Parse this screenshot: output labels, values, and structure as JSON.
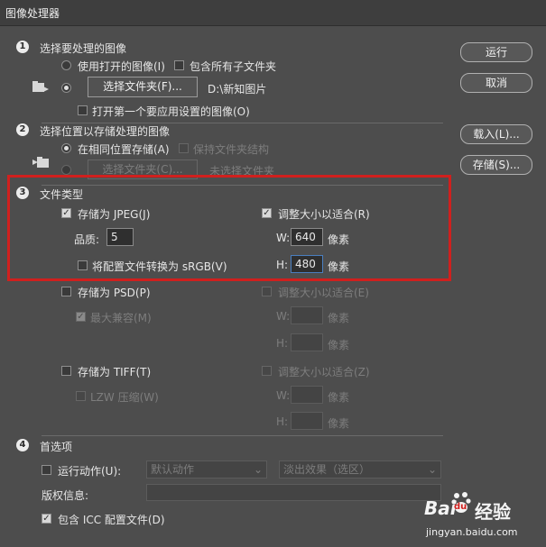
{
  "window": {
    "title": "图像处理器"
  },
  "buttons": {
    "run": "运行",
    "cancel": "取消",
    "load": "载入(L)...",
    "save": "存储(S)..."
  },
  "section1": {
    "number": "1",
    "title": "选择要处理的图像",
    "use_open_label": "使用打开的图像(I)",
    "include_sub_label": "包含所有子文件夹",
    "select_folder_label": "选择文件夹(F)...",
    "folder_path": "D:\\新知图片",
    "open_first_label": "打开第一个要应用设置的图像(O)"
  },
  "section2": {
    "number": "2",
    "title": "选择位置以存储处理的图像",
    "same_location_label": "在相同位置存储(A)",
    "keep_structure_label": "保持文件夹结构",
    "select_folder_label": "选择文件夹(C)...",
    "no_folder_label": "未选择文件夹"
  },
  "section3": {
    "number": "3",
    "title": "文件类型",
    "jpeg_label": "存储为 JPEG(J)",
    "resize_label_r": "调整大小以适合(R)",
    "quality_label": "品质:",
    "quality_value": "5",
    "w_label": "W:",
    "w_value": "640",
    "h_label": "H:",
    "h_value": "480",
    "pixels": "像素",
    "srgb_label": "将配置文件转换为 sRGB(V)",
    "psd_label": "存储为 PSD(P)",
    "resize_label_e": "调整大小以适合(E)",
    "max_compat_label": "最大兼容(M)",
    "tiff_label": "存储为 TIFF(T)",
    "resize_label_z": "调整大小以适合(Z)",
    "lzw_label": "LZW 压缩(W)"
  },
  "section4": {
    "number": "4",
    "title": "首选项",
    "run_action_label": "运行动作(U):",
    "action_set": "默认动作",
    "action_name": "淡出效果（选区）",
    "copyright_label": "版权信息:",
    "icc_label": "包含 ICC 配置文件(D)"
  },
  "watermark": {
    "brand": "Bai",
    "paw": "du",
    "suffix": "经验",
    "url": "jingyan.baidu.com"
  }
}
